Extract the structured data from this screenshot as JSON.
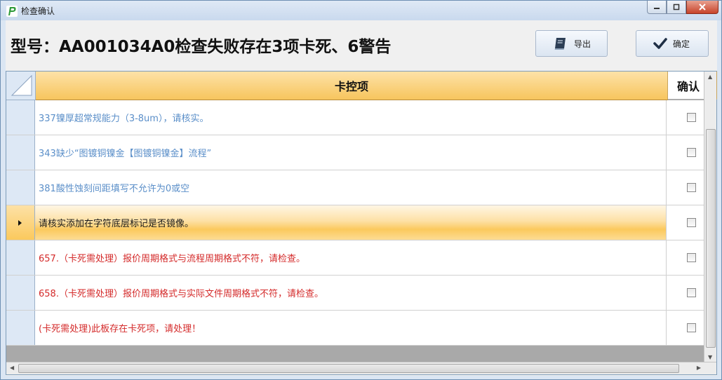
{
  "window": {
    "title": "检查确认",
    "minimize_icon": "minimize-icon",
    "maximize_icon": "maximize-icon",
    "close_icon": "close-icon"
  },
  "header": {
    "title": "型号：AA001034A0检查失败存在3项卡死、6警告",
    "export_label": "导出",
    "export_icon": "book-icon",
    "confirm_label": "确定",
    "confirm_icon": "checkmark-icon"
  },
  "grid": {
    "columns": [
      "卡控项",
      "确认"
    ],
    "rows": [
      {
        "text": "337镍厚超常规能力（3-8um），请核实。",
        "color": "#5b8fc9",
        "checked": false,
        "selected": false
      },
      {
        "text": "343缺少“图镀铜镍金【图镀铜镍金】流程”",
        "color": "#5b8fc9",
        "checked": false,
        "selected": false
      },
      {
        "text": "381酸性蚀刻间距填写不允许为0或空",
        "color": "#5b8fc9",
        "checked": false,
        "selected": false
      },
      {
        "text": "请核实添加在字符底层标记是否镜像。",
        "color": "#1a1a1a",
        "checked": false,
        "selected": true
      },
      {
        "text": "657.（卡死需处理）报价周期格式与流程周期格式不符，请检查。",
        "color": "#d42a2a",
        "checked": false,
        "selected": false
      },
      {
        "text": "658.（卡死需处理）报价周期格式与实际文件周期格式不符，请检查。",
        "color": "#d42a2a",
        "checked": false,
        "selected": false
      },
      {
        "text": "(卡死需处理)此板存在卡死项，请处理！",
        "color": "#d42a2a",
        "checked": false,
        "selected": false
      }
    ]
  }
}
